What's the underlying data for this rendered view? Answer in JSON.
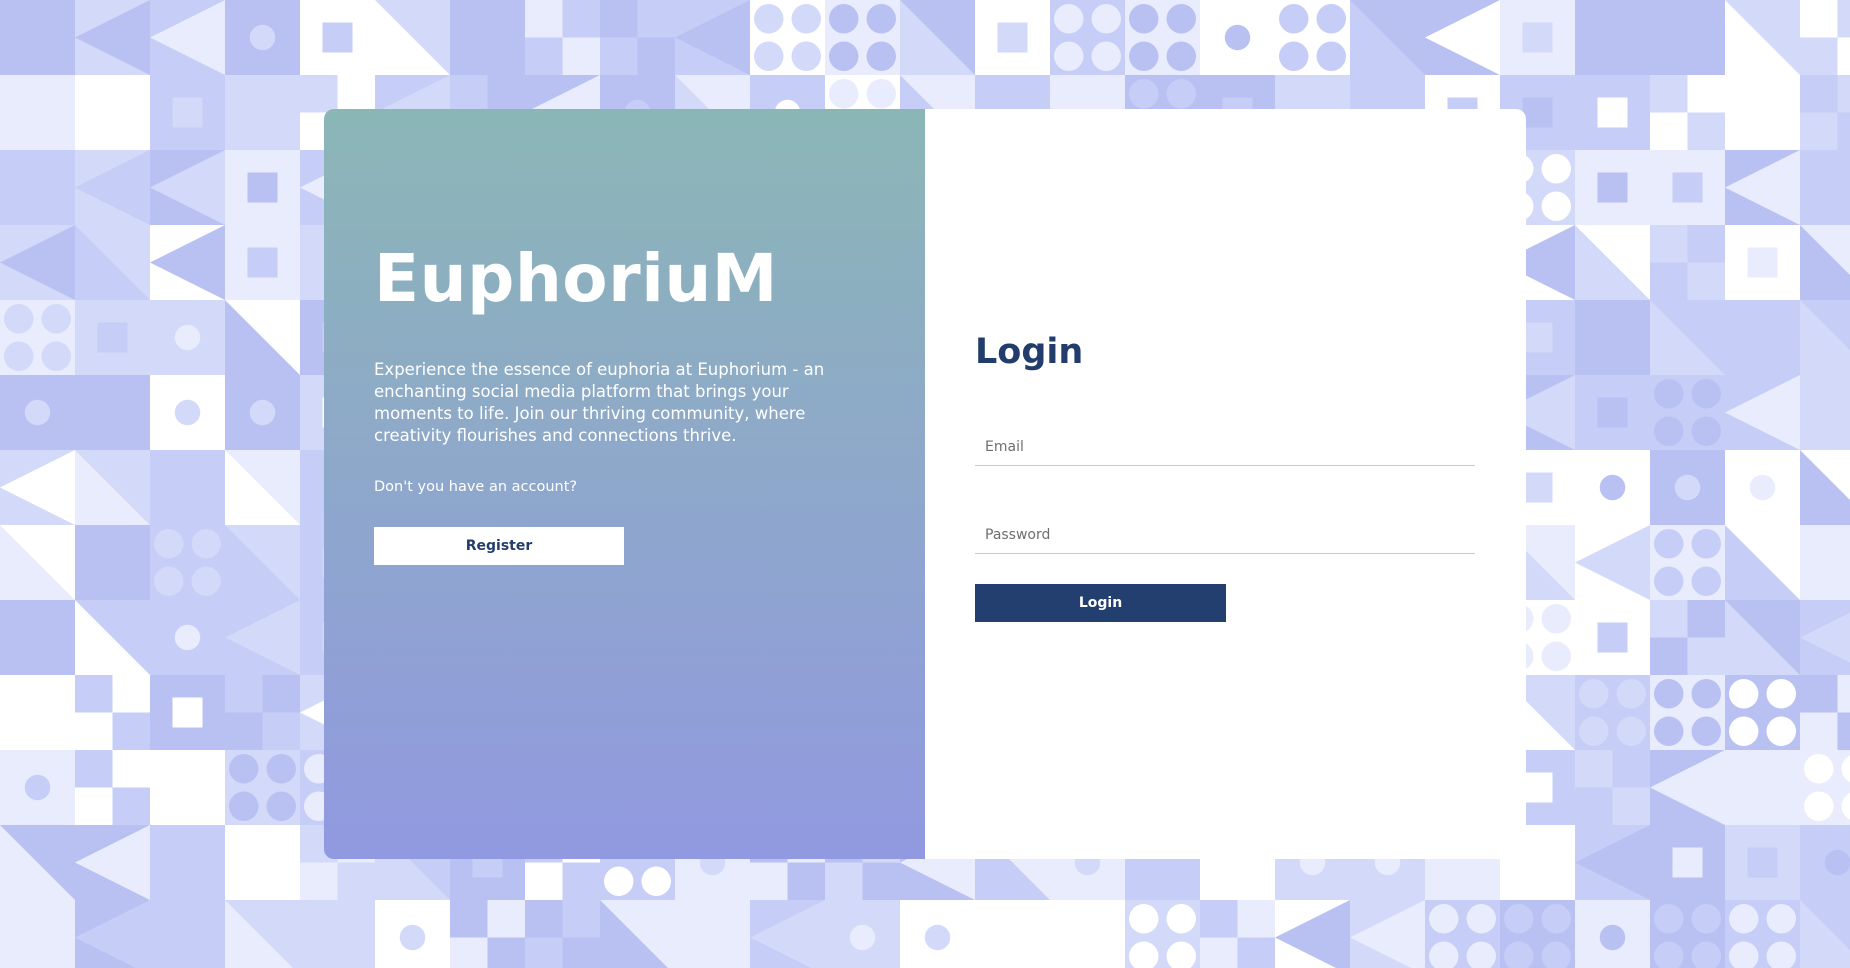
{
  "theme": {
    "accent": "#233f6f",
    "gradient_top": "#8bb6b6",
    "gradient_bottom": "#9199e0",
    "background": "#e3e7fb"
  },
  "brand": {
    "name": "EuphoriuM",
    "description": "Experience the essence of euphoria at Euphorium - an enchanting social media platform that brings your moments to life. Join our thriving community, where creativity flourishes and connections thrive.",
    "account_prompt": "Don't you have an account?",
    "register_label": "Register"
  },
  "login": {
    "title": "Login",
    "email_placeholder": "Email",
    "email_value": "",
    "password_placeholder": "Password",
    "password_value": "",
    "submit_label": "Login"
  }
}
